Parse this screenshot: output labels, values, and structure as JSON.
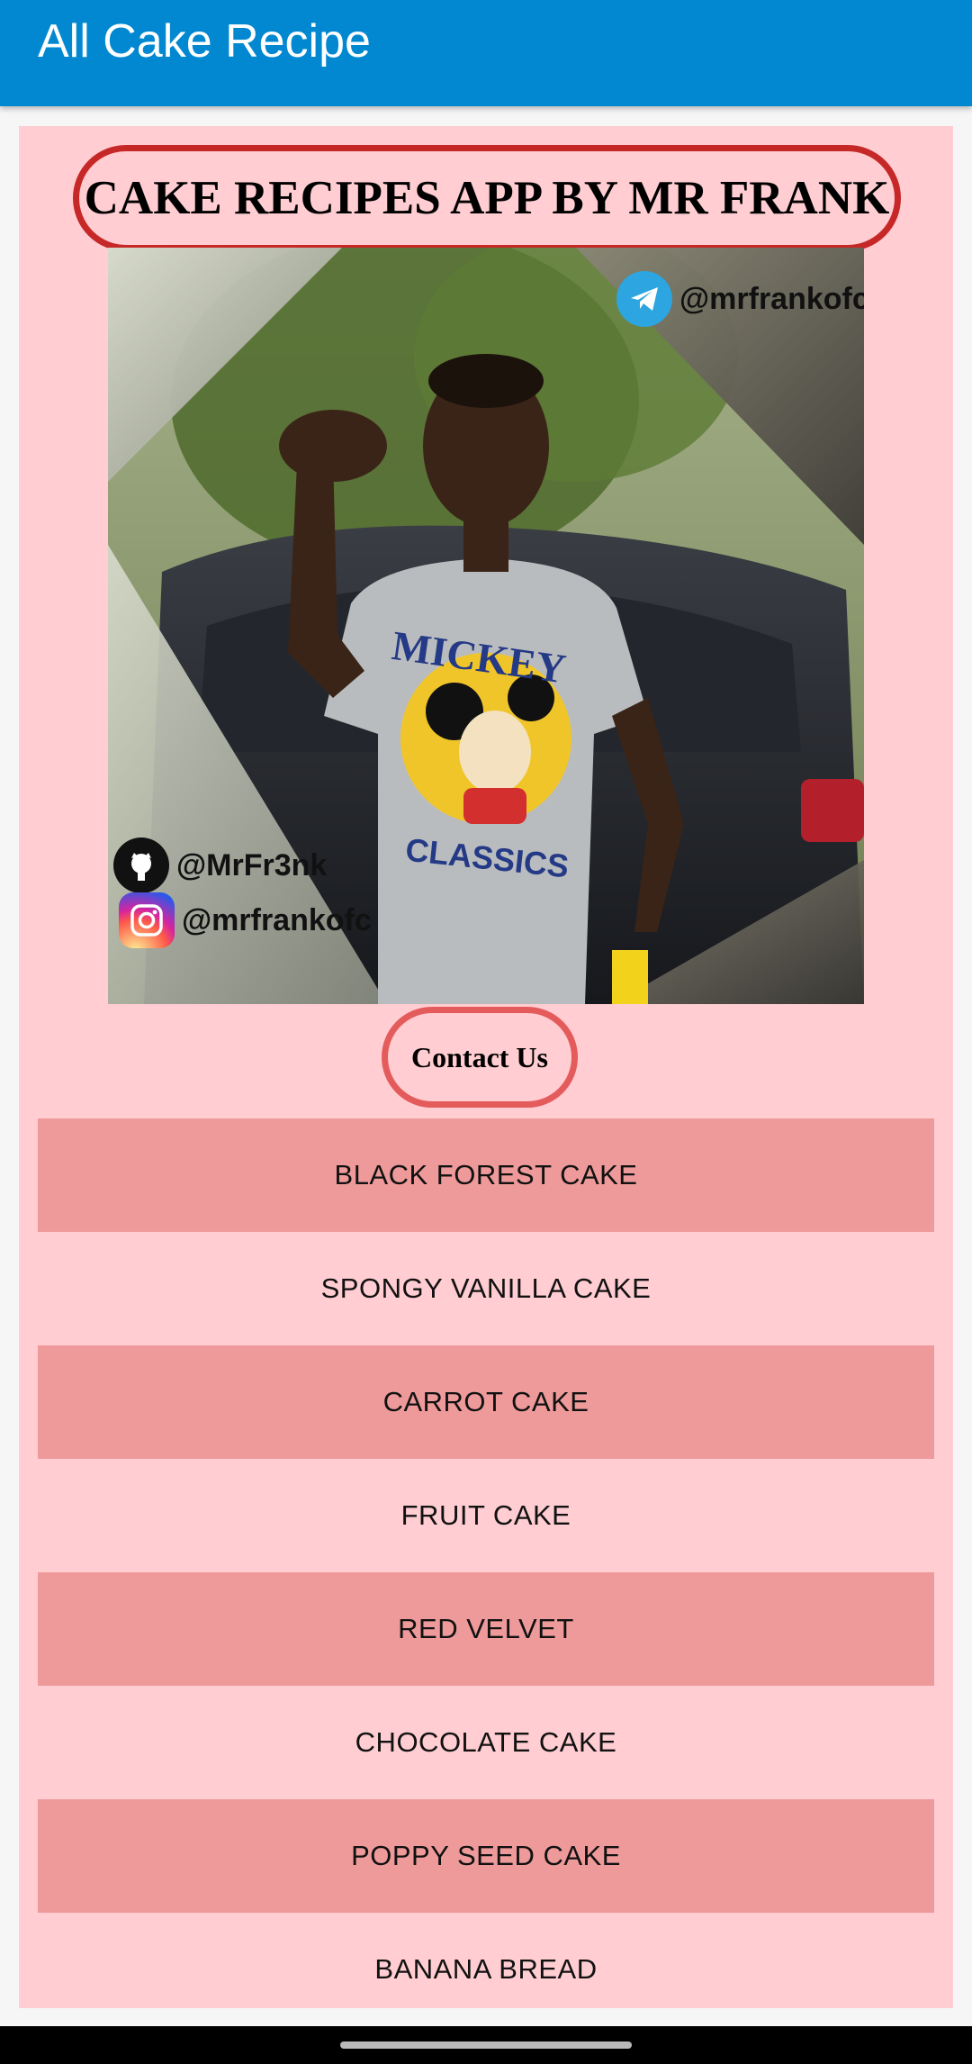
{
  "app_bar": {
    "title": "All Cake Recipe"
  },
  "banner": {
    "text": "CAKE RECIPES APP BY MR FRANK"
  },
  "photo": {
    "telegram_handle": "@mrfrankofc",
    "github_handle": "@MrFr3nk",
    "instagram_handle": "@mrfrankofc",
    "shirt_text_top": "MICKEY",
    "shirt_text_bottom": "CLASSICS"
  },
  "contact": {
    "label": "Contact Us"
  },
  "recipes": [
    {
      "label": "BLACK FOREST CAKE"
    },
    {
      "label": "SPONGY VANILLA CAKE"
    },
    {
      "label": "CARROT CAKE"
    },
    {
      "label": "FRUIT CAKE"
    },
    {
      "label": "RED VELVET"
    },
    {
      "label": "CHOCOLATE CAKE"
    },
    {
      "label": "POPPY SEED CAKE"
    },
    {
      "label": "BANANA BREAD"
    }
  ],
  "colors": {
    "app_bar": "#0288d1",
    "panel": "#ffcdd2",
    "row_shaded": "#ef9a9a",
    "banner_border": "#c62828",
    "contact_border": "#e45b5b"
  },
  "icons": {
    "telegram": "telegram-icon",
    "github": "github-icon",
    "instagram": "instagram-icon"
  }
}
